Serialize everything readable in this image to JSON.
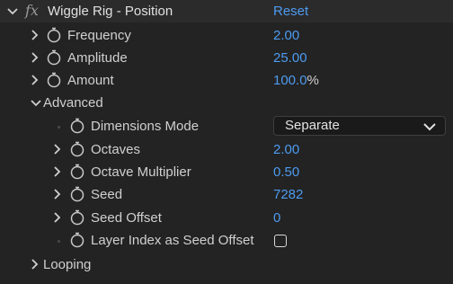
{
  "effect": {
    "fx_label": "fx",
    "name": "Wiggle Rig - Position",
    "reset_label": "Reset"
  },
  "properties": {
    "frequency": {
      "label": "Frequency",
      "value": "2.00"
    },
    "amplitude": {
      "label": "Amplitude",
      "value": "25.00"
    },
    "amount": {
      "label": "Amount",
      "value": "100.0",
      "unit": "%"
    }
  },
  "advanced": {
    "label": "Advanced",
    "dimensions_mode": {
      "label": "Dimensions Mode",
      "selected": "Separate"
    },
    "octaves": {
      "label": "Octaves",
      "value": "2.00"
    },
    "octave_multiplier": {
      "label": "Octave Multiplier",
      "value": "0.50"
    },
    "seed": {
      "label": "Seed",
      "value": "7282"
    },
    "seed_offset": {
      "label": "Seed Offset",
      "value": "0"
    },
    "layer_index_as_seed_offset": {
      "label": "Layer Index as Seed Offset",
      "checked": false
    }
  },
  "looping": {
    "label": "Looping"
  },
  "colors": {
    "value_blue": "#4d9bf0",
    "panel_bg": "#232323",
    "header_bg": "#2b2b2b"
  }
}
